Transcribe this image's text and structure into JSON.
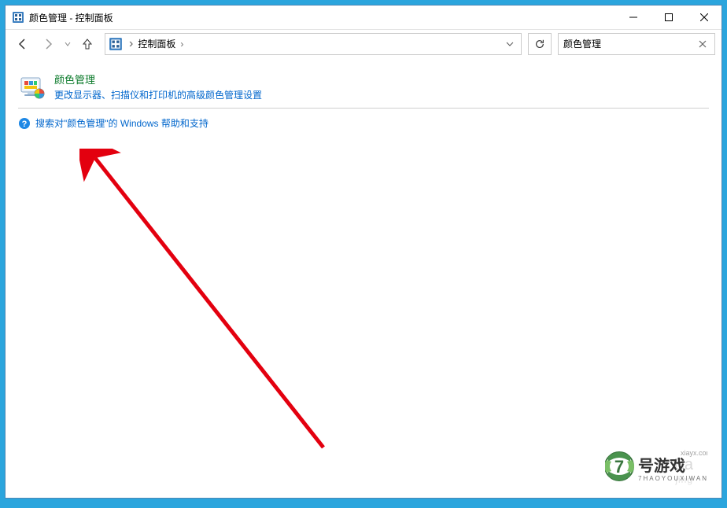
{
  "titlebar": {
    "title": "颜色管理 - 控制面板"
  },
  "breadcrumb": {
    "items": [
      "控制面板"
    ]
  },
  "search": {
    "value": "颜色管理"
  },
  "result": {
    "title": "颜色管理",
    "description": "更改显示器、扫描仪和打印机的高级颜色管理设置"
  },
  "help": {
    "text": "搜索对\"颜色管理\"的 Windows 帮助和支持"
  },
  "watermark": {
    "brand_cn": "号游戏",
    "brand_num": "7",
    "brand_site": "xiayx.com",
    "bg_top": "Ba",
    "bg_sub": "jing"
  }
}
